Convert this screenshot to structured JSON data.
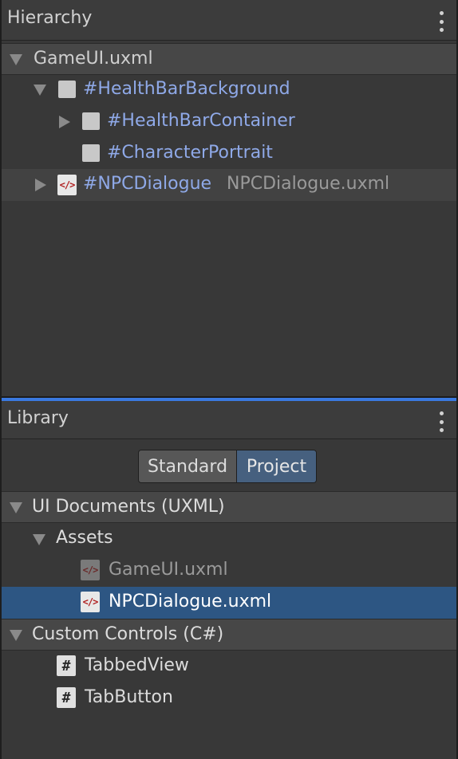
{
  "hierarchy": {
    "title": "Hierarchy",
    "root": "GameUI.uxml",
    "items": [
      {
        "name": "#HealthBarBackground"
      },
      {
        "name": "#HealthBarContainer"
      },
      {
        "name": "#CharacterPortrait"
      },
      {
        "name": "#NPCDialogue",
        "template": "NPCDialogue.uxml"
      }
    ]
  },
  "library": {
    "title": "Library",
    "tabs": [
      "Standard",
      "Project"
    ],
    "active_tab": "Project",
    "sections": [
      {
        "label": "UI Documents (UXML)",
        "folders": [
          {
            "label": "Assets",
            "files": [
              "GameUI.uxml",
              "NPCDialogue.uxml"
            ]
          }
        ]
      },
      {
        "label": "Custom Controls (C#)",
        "controls": [
          "TabbedView",
          "TabButton"
        ]
      }
    ],
    "selected": "NPCDialogue.uxml"
  },
  "icons": {
    "uxml": "</>",
    "csharp": "#"
  },
  "colors": {
    "accent": "#3a79e0",
    "selection": "#2d5683",
    "element_name": "#8fa9e8"
  }
}
